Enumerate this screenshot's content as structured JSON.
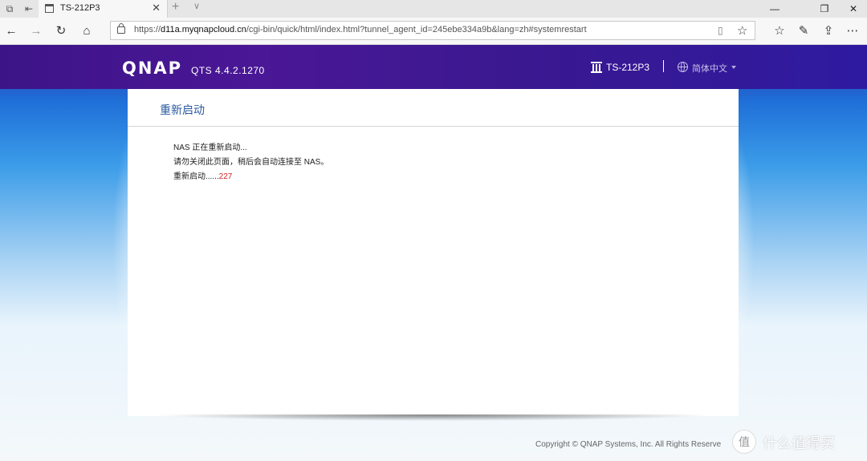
{
  "browser": {
    "tab_title": "TS-212P3",
    "url_scheme": "https://",
    "url_host": "d11a.myqnapcloud.cn",
    "url_rest": "/cgi-bin/quick/html/index.html?tunnel_agent_id=245ebe334a9b&lang=zh#systemrestart"
  },
  "header": {
    "logo": "QNAP",
    "version": "QTS 4.4.2.1270",
    "model": "TS-212P3",
    "language": "简体中文"
  },
  "panel": {
    "title": "重新启动",
    "line1": "NAS 正在重新启动...",
    "line2": "请勿关闭此页面，稍后会自动连接至 NAS。",
    "line3_prefix": "重新启动......",
    "countdown": "227"
  },
  "footer": {
    "copyright": "Copyright © QNAP Systems, Inc. All Rights Reserve"
  },
  "watermark": {
    "text": "什么值得买",
    "badge": "值"
  }
}
